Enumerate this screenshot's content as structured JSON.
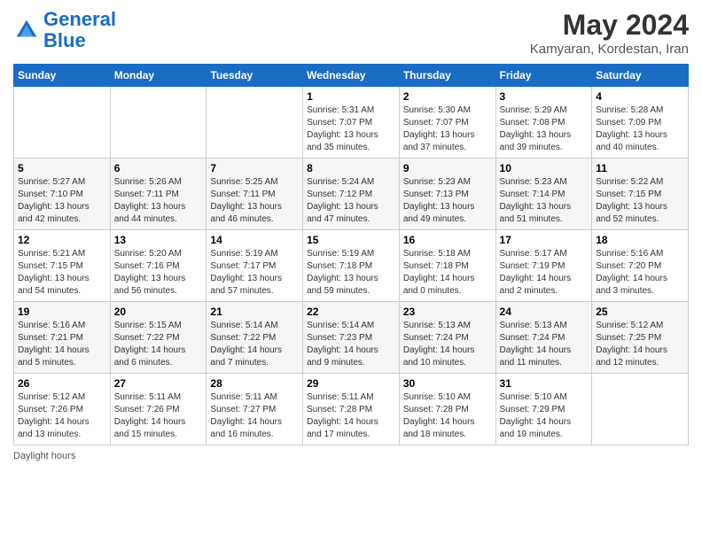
{
  "header": {
    "logo_line1": "General",
    "logo_line2": "Blue",
    "title": "May 2024",
    "subtitle": "Kamyaran, Kordestan, Iran"
  },
  "days_of_week": [
    "Sunday",
    "Monday",
    "Tuesday",
    "Wednesday",
    "Thursday",
    "Friday",
    "Saturday"
  ],
  "weeks": [
    [
      {
        "day": "",
        "info": ""
      },
      {
        "day": "",
        "info": ""
      },
      {
        "day": "",
        "info": ""
      },
      {
        "day": "1",
        "info": "Sunrise: 5:31 AM\nSunset: 7:07 PM\nDaylight: 13 hours\nand 35 minutes."
      },
      {
        "day": "2",
        "info": "Sunrise: 5:30 AM\nSunset: 7:07 PM\nDaylight: 13 hours\nand 37 minutes."
      },
      {
        "day": "3",
        "info": "Sunrise: 5:29 AM\nSunset: 7:08 PM\nDaylight: 13 hours\nand 39 minutes."
      },
      {
        "day": "4",
        "info": "Sunrise: 5:28 AM\nSunset: 7:09 PM\nDaylight: 13 hours\nand 40 minutes."
      }
    ],
    [
      {
        "day": "5",
        "info": "Sunrise: 5:27 AM\nSunset: 7:10 PM\nDaylight: 13 hours\nand 42 minutes."
      },
      {
        "day": "6",
        "info": "Sunrise: 5:26 AM\nSunset: 7:11 PM\nDaylight: 13 hours\nand 44 minutes."
      },
      {
        "day": "7",
        "info": "Sunrise: 5:25 AM\nSunset: 7:11 PM\nDaylight: 13 hours\nand 46 minutes."
      },
      {
        "day": "8",
        "info": "Sunrise: 5:24 AM\nSunset: 7:12 PM\nDaylight: 13 hours\nand 47 minutes."
      },
      {
        "day": "9",
        "info": "Sunrise: 5:23 AM\nSunset: 7:13 PM\nDaylight: 13 hours\nand 49 minutes."
      },
      {
        "day": "10",
        "info": "Sunrise: 5:23 AM\nSunset: 7:14 PM\nDaylight: 13 hours\nand 51 minutes."
      },
      {
        "day": "11",
        "info": "Sunrise: 5:22 AM\nSunset: 7:15 PM\nDaylight: 13 hours\nand 52 minutes."
      }
    ],
    [
      {
        "day": "12",
        "info": "Sunrise: 5:21 AM\nSunset: 7:15 PM\nDaylight: 13 hours\nand 54 minutes."
      },
      {
        "day": "13",
        "info": "Sunrise: 5:20 AM\nSunset: 7:16 PM\nDaylight: 13 hours\nand 56 minutes."
      },
      {
        "day": "14",
        "info": "Sunrise: 5:19 AM\nSunset: 7:17 PM\nDaylight: 13 hours\nand 57 minutes."
      },
      {
        "day": "15",
        "info": "Sunrise: 5:19 AM\nSunset: 7:18 PM\nDaylight: 13 hours\nand 59 minutes."
      },
      {
        "day": "16",
        "info": "Sunrise: 5:18 AM\nSunset: 7:18 PM\nDaylight: 14 hours\nand 0 minutes."
      },
      {
        "day": "17",
        "info": "Sunrise: 5:17 AM\nSunset: 7:19 PM\nDaylight: 14 hours\nand 2 minutes."
      },
      {
        "day": "18",
        "info": "Sunrise: 5:16 AM\nSunset: 7:20 PM\nDaylight: 14 hours\nand 3 minutes."
      }
    ],
    [
      {
        "day": "19",
        "info": "Sunrise: 5:16 AM\nSunset: 7:21 PM\nDaylight: 14 hours\nand 5 minutes."
      },
      {
        "day": "20",
        "info": "Sunrise: 5:15 AM\nSunset: 7:22 PM\nDaylight: 14 hours\nand 6 minutes."
      },
      {
        "day": "21",
        "info": "Sunrise: 5:14 AM\nSunset: 7:22 PM\nDaylight: 14 hours\nand 7 minutes."
      },
      {
        "day": "22",
        "info": "Sunrise: 5:14 AM\nSunset: 7:23 PM\nDaylight: 14 hours\nand 9 minutes."
      },
      {
        "day": "23",
        "info": "Sunrise: 5:13 AM\nSunset: 7:24 PM\nDaylight: 14 hours\nand 10 minutes."
      },
      {
        "day": "24",
        "info": "Sunrise: 5:13 AM\nSunset: 7:24 PM\nDaylight: 14 hours\nand 11 minutes."
      },
      {
        "day": "25",
        "info": "Sunrise: 5:12 AM\nSunset: 7:25 PM\nDaylight: 14 hours\nand 12 minutes."
      }
    ],
    [
      {
        "day": "26",
        "info": "Sunrise: 5:12 AM\nSunset: 7:26 PM\nDaylight: 14 hours\nand 13 minutes."
      },
      {
        "day": "27",
        "info": "Sunrise: 5:11 AM\nSunset: 7:26 PM\nDaylight: 14 hours\nand 15 minutes."
      },
      {
        "day": "28",
        "info": "Sunrise: 5:11 AM\nSunset: 7:27 PM\nDaylight: 14 hours\nand 16 minutes."
      },
      {
        "day": "29",
        "info": "Sunrise: 5:11 AM\nSunset: 7:28 PM\nDaylight: 14 hours\nand 17 minutes."
      },
      {
        "day": "30",
        "info": "Sunrise: 5:10 AM\nSunset: 7:28 PM\nDaylight: 14 hours\nand 18 minutes."
      },
      {
        "day": "31",
        "info": "Sunrise: 5:10 AM\nSunset: 7:29 PM\nDaylight: 14 hours\nand 19 minutes."
      },
      {
        "day": "",
        "info": ""
      }
    ]
  ],
  "footer": {
    "daylight_hours_label": "Daylight hours"
  }
}
